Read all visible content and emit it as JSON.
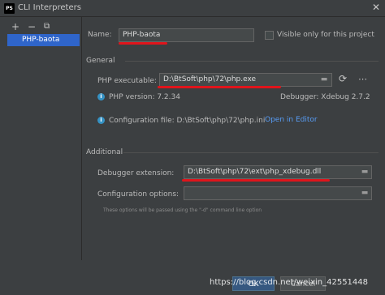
{
  "window": {
    "title": "CLI Interpreters",
    "icon_text": "PS"
  },
  "left_panel": {
    "toolbar": {
      "add": "+",
      "remove": "−",
      "copy": "⧉"
    },
    "items": [
      {
        "label": "PHP-baota"
      }
    ]
  },
  "name": {
    "label": "Name:",
    "value": "PHP-baota"
  },
  "visible_only": {
    "label": "Visible only for this project",
    "checked": false
  },
  "general": {
    "heading": "General",
    "php_exec_label": "PHP executable:",
    "php_exec_value": "D:\\BtSoft\\php\\72\\php.exe",
    "php_version": "PHP version: 7.2.34",
    "debugger": "Debugger: Xdebug 2.7.2",
    "config_file": "Configuration file: D:\\BtSoft\\php\\72\\php.ini",
    "open_in_editor": "Open in Editor"
  },
  "additional": {
    "heading": "Additional",
    "debugger_ext_label": "Debugger extension:",
    "debugger_ext_value": "D:\\BtSoft\\php\\72\\ext\\php_xdebug.dll",
    "config_options_label": "Configuration options:",
    "config_options_value": "",
    "hint": "These options will be passed using the \"-d\" command line option"
  },
  "buttons": {
    "ok": "OK",
    "cancel": "Cancel"
  },
  "watermark": "https://blog.csdn.net/weixin_42551448",
  "colors": {
    "accent": "#2f65ca",
    "annotation": "#e0141b",
    "link": "#589df6"
  }
}
